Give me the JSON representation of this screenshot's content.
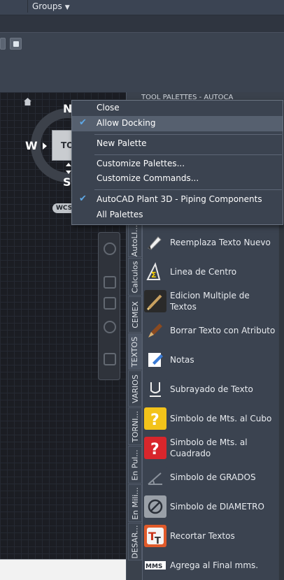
{
  "topbar": {
    "groups_label": "Groups"
  },
  "viewcube": {
    "north": "N",
    "south": "S",
    "west": "W",
    "face_label": "TO",
    "wcs_label": "WCS"
  },
  "palette": {
    "title": "TOOL PALETTES - AUTOCA",
    "tabs": [
      "AutoLI...",
      "Calculos",
      "CEMEX",
      "TEXTOS",
      "VARIOS",
      "TORNI...",
      "En Pul...",
      "En Mili...",
      "DESAR..."
    ],
    "active_tab": "TEXTOS",
    "items": [
      {
        "label": "Reemplaza Texto Nuevo",
        "icon": "replace-text-icon"
      },
      {
        "label": "Linea de Centro",
        "icon": "centerline-icon"
      },
      {
        "label": "Edicion Multiple de Textos",
        "icon": "multi-edit-text-icon"
      },
      {
        "label": "Borrar Texto con Atributo",
        "icon": "brush-erase-icon"
      },
      {
        "label": "Notas",
        "icon": "notes-icon"
      },
      {
        "label": "Subrayado de Texto",
        "icon": "underline-icon"
      },
      {
        "label": "Simbolo de Mts. al Cubo",
        "icon": "question-yellow-icon"
      },
      {
        "label": "Simbolo de Mts. al Cuadrado",
        "icon": "question-red-icon"
      },
      {
        "label": "Simbolo de GRADOS",
        "icon": "degree-icon"
      },
      {
        "label": "Simbolo de DIAMETRO",
        "icon": "diameter-icon"
      },
      {
        "label": "Recortar Textos",
        "icon": "trim-text-icon"
      },
      {
        "label": "Agrega al Final mms.",
        "icon": "mms-icon"
      }
    ]
  },
  "context_menu": {
    "items": [
      {
        "label": "Close",
        "checked": false
      },
      {
        "label": "Allow Docking",
        "checked": true
      },
      {
        "label": "New Palette",
        "checked": false
      },
      {
        "label": "Customize Palettes...",
        "checked": false
      },
      {
        "label": "Customize Commands...",
        "checked": false
      },
      {
        "label": "AutoCAD Plant 3D - Piping Components",
        "checked": true
      },
      {
        "label": "All Palettes",
        "checked": false
      }
    ]
  },
  "colors": {
    "accent": "#5fa8e6",
    "menu_bg": "#3b4350",
    "canvas": "#1b1d23"
  }
}
